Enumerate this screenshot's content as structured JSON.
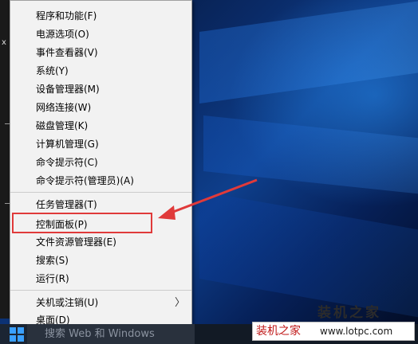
{
  "menu": {
    "items": [
      "程序和功能(F)",
      "电源选项(O)",
      "事件查看器(V)",
      "系统(Y)",
      "设备管理器(M)",
      "网络连接(W)",
      "磁盘管理(K)",
      "计算机管理(G)",
      "命令提示符(C)",
      "命令提示符(管理员)(A)",
      "任务管理器(T)",
      "控制面板(P)",
      "文件资源管理器(E)",
      "搜索(S)",
      "运行(R)",
      "关机或注销(U)",
      "桌面(D)"
    ],
    "submenu_glyph": "〉"
  },
  "left_strip": {
    "mark": "x"
  },
  "taskbar": {
    "search_placeholder": "搜索 Web 和 Windows"
  },
  "watermark": {
    "big": "装机之家",
    "name": "装机之家",
    "url": "www.lotpc.com"
  },
  "colors": {
    "highlight": "#e03a3a",
    "accent": "#3aa0ff"
  }
}
